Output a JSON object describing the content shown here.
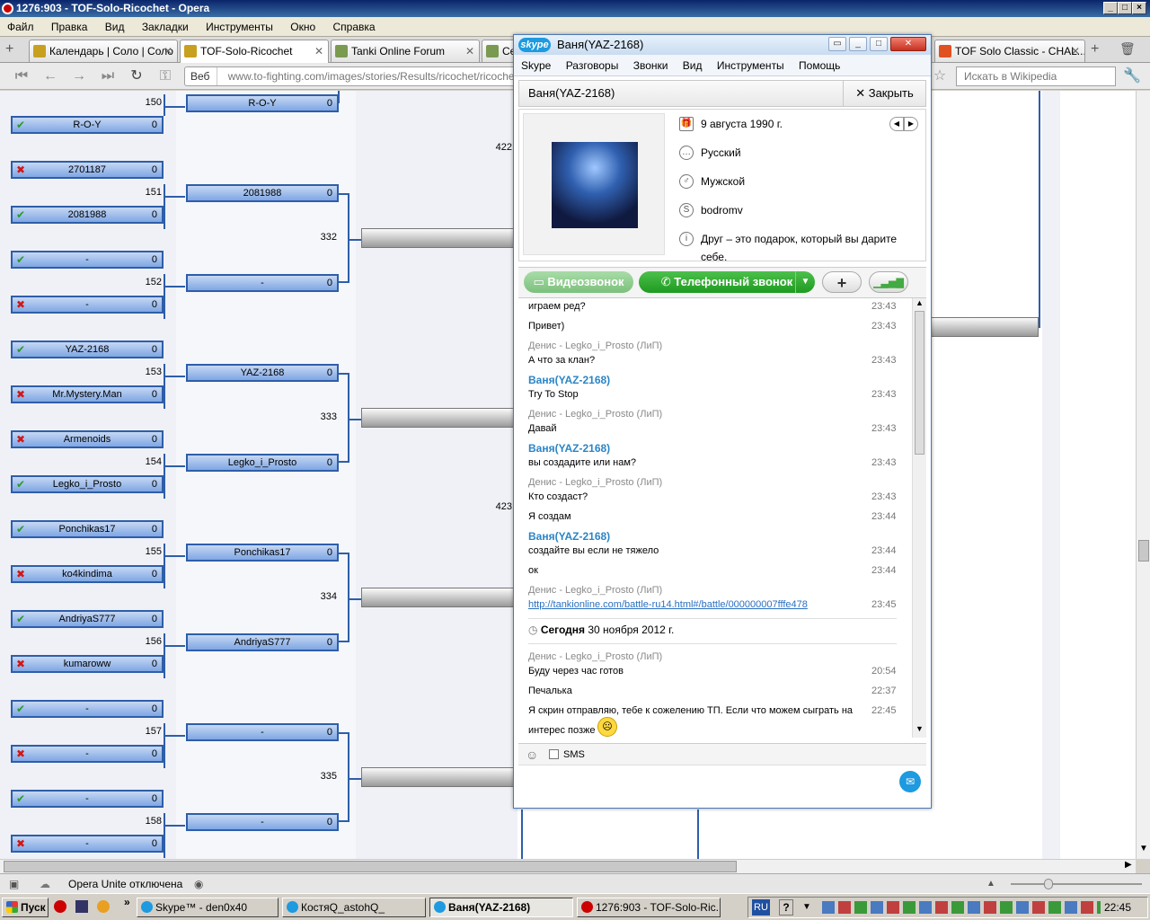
{
  "opera": {
    "title": "1276:903 - TOF-Solo-Ricochet - Opera",
    "menu": [
      "Файл",
      "Правка",
      "Вид",
      "Закладки",
      "Инструменты",
      "Окно",
      "Справка"
    ],
    "tabs": [
      {
        "label": "Календарь | Соло | Соло"
      },
      {
        "label": "TOF-Solo-Ricochet"
      },
      {
        "label": "Tanki Online Forum"
      },
      {
        "label": "Се"
      },
      {
        "label": "TOF Solo Classic - CHAL..."
      }
    ],
    "address": {
      "web_label": "Веб",
      "url": "www.to-fighting.com/images/stories/Results/ricochet/ricochet..."
    },
    "search_placeholder": "Искать в Wikipedia",
    "status_text": "Opera Unite отключена"
  },
  "bracket": {
    "round1": [
      {
        "name": "R-O-Y",
        "score": "0",
        "status": "win"
      },
      {
        "name": "2701187",
        "score": "0",
        "status": "lose"
      },
      {
        "name": "2081988",
        "score": "0",
        "status": "win"
      },
      {
        "name": "-",
        "score": "0",
        "status": "win"
      },
      {
        "name": "-",
        "score": "0",
        "status": "lose"
      },
      {
        "name": "YAZ-2168",
        "score": "0",
        "status": "win"
      },
      {
        "name": "Mr.Mystery.Man",
        "score": "0",
        "status": "lose"
      },
      {
        "name": "Armenoids",
        "score": "0",
        "status": "lose"
      },
      {
        "name": "Legko_i_Prosto",
        "score": "0",
        "status": "win"
      },
      {
        "name": "Ponchikas17",
        "score": "0",
        "status": "win"
      },
      {
        "name": "ko4kindima",
        "score": "0",
        "status": "lose"
      },
      {
        "name": "AndriyaS777",
        "score": "0",
        "status": "win"
      },
      {
        "name": "kumaroww",
        "score": "0",
        "status": "lose"
      },
      {
        "name": "-",
        "score": "0",
        "status": "win"
      },
      {
        "name": "-",
        "score": "0",
        "status": "lose"
      },
      {
        "name": "-",
        "score": "0",
        "status": "win"
      },
      {
        "name": "-",
        "score": "0",
        "status": "lose"
      }
    ],
    "round1_match_numbers": [
      "150",
      "151",
      "152",
      "153",
      "154",
      "155",
      "156",
      "157",
      "158"
    ],
    "round2": [
      {
        "name": "R-O-Y",
        "score": "0"
      },
      {
        "name": "2081988",
        "score": "0"
      },
      {
        "name": "-",
        "score": "0"
      },
      {
        "name": "YAZ-2168",
        "score": "0"
      },
      {
        "name": "Legko_i_Prosto",
        "score": "0"
      },
      {
        "name": "Ponchikas17",
        "score": "0"
      },
      {
        "name": "AndriyaS777",
        "score": "0"
      },
      {
        "name": "-",
        "score": "0"
      },
      {
        "name": "-",
        "score": "0"
      }
    ],
    "round2_match_numbers": [
      "332",
      "333",
      "334",
      "335"
    ],
    "round3_match_numbers": [
      "422",
      "423"
    ]
  },
  "skype": {
    "title": "Ваня(YAZ-2168)",
    "logo": "skype",
    "menu": [
      "Skype",
      "Разговоры",
      "Звонки",
      "Вид",
      "Инструменты",
      "Помощь"
    ],
    "contact_name": "Ваня(YAZ-2168)",
    "close_label": "Закрыть",
    "profile": {
      "birthday": "9 августа 1990 г.",
      "language": "Русский",
      "gender": "Мужской",
      "skype_name": "bodromv",
      "mood": "Друг – это подарок, который вы дарите себе."
    },
    "video_call": "Видеозвонок",
    "phone_call": "Телефонный звонок",
    "messages": [
      {
        "type": "text",
        "text": "играем ред?",
        "time": "23:43"
      },
      {
        "type": "text",
        "text": "Привет)",
        "time": "23:43"
      },
      {
        "type": "sender",
        "text": "Денис - Legko_i_Prosto (ЛиП)"
      },
      {
        "type": "text",
        "text": "А что за клан?",
        "time": "23:43"
      },
      {
        "type": "me",
        "text": "Ваня(YAZ-2168)"
      },
      {
        "type": "text",
        "text": "Try To Stop",
        "time": "23:43"
      },
      {
        "type": "sender",
        "text": "Денис - Legko_i_Prosto (ЛиП)"
      },
      {
        "type": "text",
        "text": "Давай",
        "time": "23:43"
      },
      {
        "type": "me",
        "text": "Ваня(YAZ-2168)"
      },
      {
        "type": "text",
        "text": "вы создадите или нам?",
        "time": "23:43"
      },
      {
        "type": "sender",
        "text": "Денис - Legko_i_Prosto (ЛиП)"
      },
      {
        "type": "text",
        "text": "Кто создаст?",
        "time": "23:43"
      },
      {
        "type": "text",
        "text": "Я создам",
        "time": "23:44"
      },
      {
        "type": "me",
        "text": "Ваня(YAZ-2168)"
      },
      {
        "type": "text",
        "text": "создайте вы если не тяжело",
        "time": "23:44"
      },
      {
        "type": "text",
        "text": "ок",
        "time": "23:44"
      },
      {
        "type": "sender",
        "text": "Денис - Legko_i_Prosto (ЛиП)"
      },
      {
        "type": "link",
        "text": "http://tankionline.com/battle-ru14.html#/battle/000000007fffe478",
        "time": "23:45"
      }
    ],
    "today_label": "Сегодня",
    "today_date": "30 ноября 2012 г.",
    "messages_today": [
      {
        "type": "sender",
        "text": "Денис - Legko_i_Prosto (ЛиП)"
      },
      {
        "type": "text",
        "text": "Буду через час готов",
        "time": "20:54"
      },
      {
        "type": "text",
        "text": "Печалька",
        "time": "22:37"
      },
      {
        "type": "text",
        "text": "Я скрин отправляю, тебе к сожелению ТП. Если что можем сыграть на",
        "time": "22:45"
      },
      {
        "type": "text",
        "text": "интерес позже",
        "time": ""
      }
    ],
    "sms_label": "SMS"
  },
  "taskbar": {
    "start": "Пуск",
    "items": [
      {
        "label": "Skype™ - den0x40"
      },
      {
        "label": "КостяQ_astohQ_"
      },
      {
        "label": "Ваня(YAZ-2168)"
      },
      {
        "label": "1276:903 - TOF-Solo-Ric..."
      }
    ],
    "lang": "RU",
    "clock": "22:45"
  }
}
